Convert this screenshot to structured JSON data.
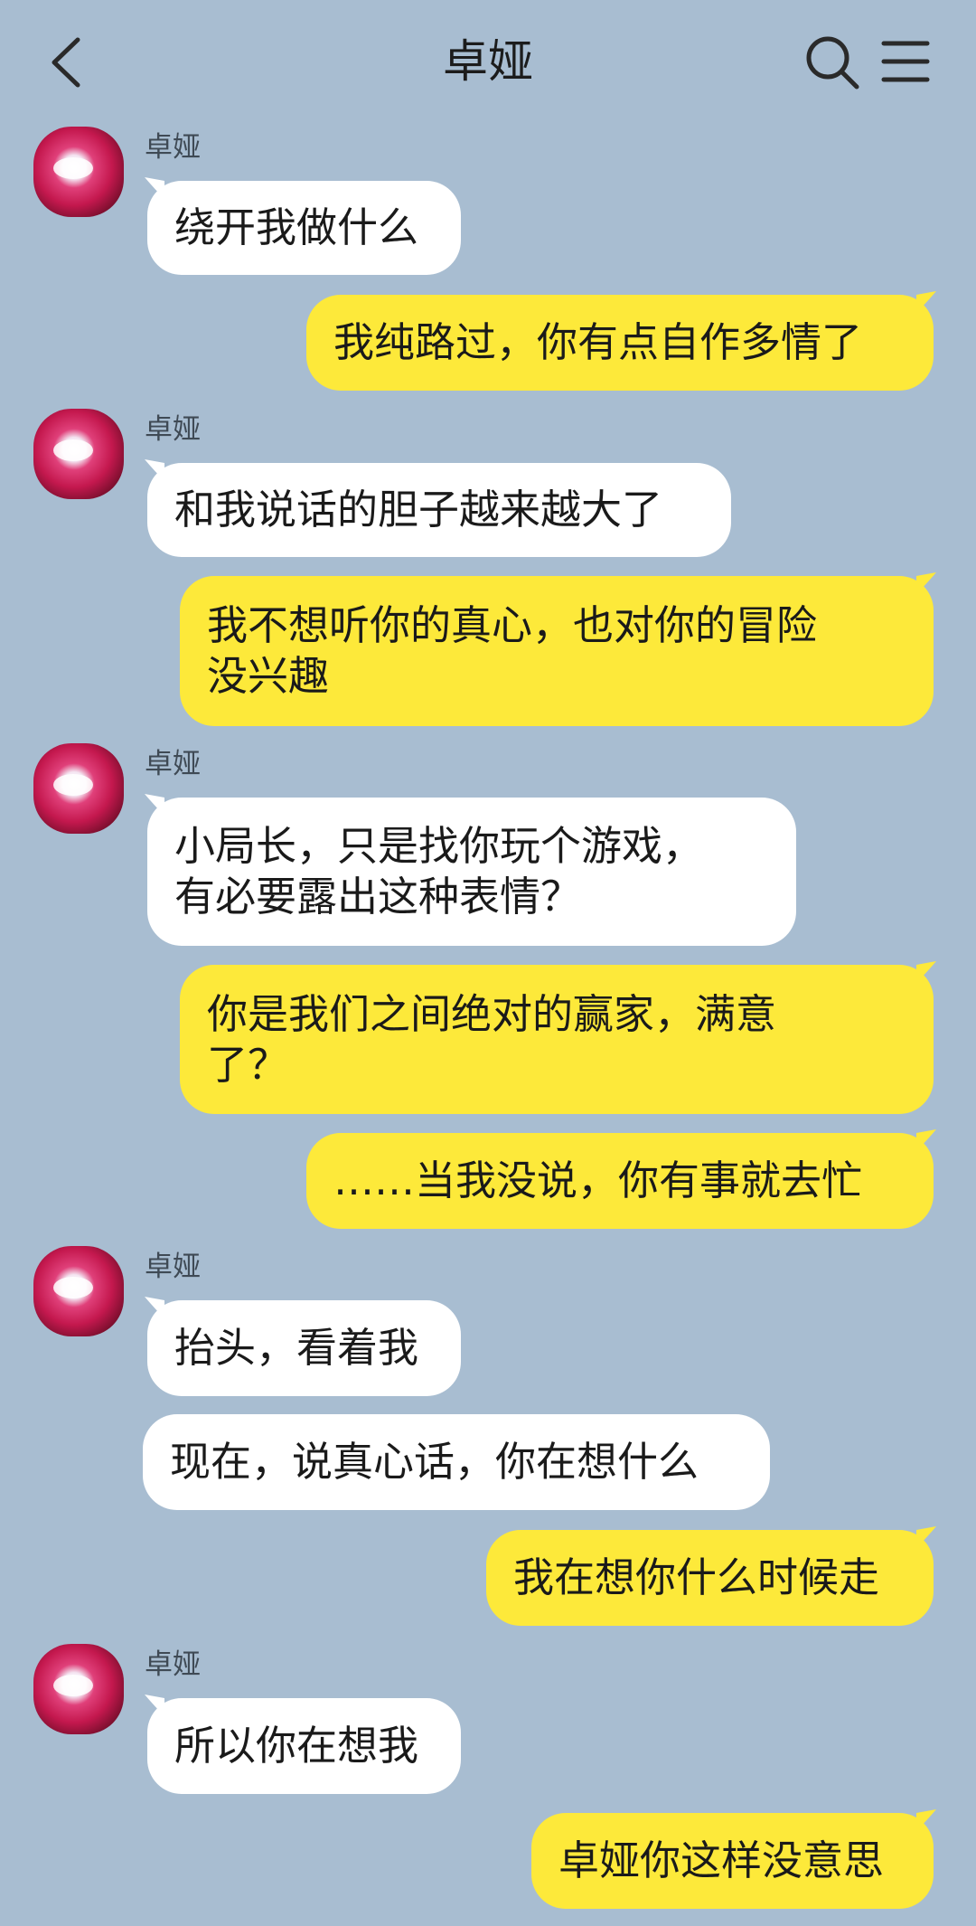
{
  "header": {
    "title": "卓娅"
  },
  "contact": {
    "name": "卓娅"
  },
  "messages": [
    {
      "from": "contact",
      "text": "绕开我做什么"
    },
    {
      "from": "me",
      "text": "我纯路过，你有点自作多情了"
    },
    {
      "from": "contact",
      "text": "和我说话的胆子越来越大了"
    },
    {
      "from": "me",
      "text": "我不想听你的真心，也对你的冒险\n没兴趣"
    },
    {
      "from": "contact",
      "text": "小局长，只是找你玩个游戏，\n有必要露出这种表情？"
    },
    {
      "from": "me",
      "text": "你是我们之间绝对的赢家，满意\n了？"
    },
    {
      "from": "me",
      "text": "……当我没说，你有事就去忙"
    },
    {
      "from": "contact",
      "text": "抬头，看着我"
    },
    {
      "from": "contact",
      "text": "现在，说真心话，你在想什么"
    },
    {
      "from": "me",
      "text": "我在想你什么时候走"
    },
    {
      "from": "contact",
      "text": "所以你在想我"
    },
    {
      "from": "me",
      "text": "卓娅你这样没意思"
    }
  ],
  "colors": {
    "background": "#a8bdd1",
    "incoming_bubble": "#ffffff",
    "outgoing_bubble": "#fde93a"
  },
  "icons": [
    "back-arrow-icon",
    "search-icon",
    "menu-icon"
  ]
}
